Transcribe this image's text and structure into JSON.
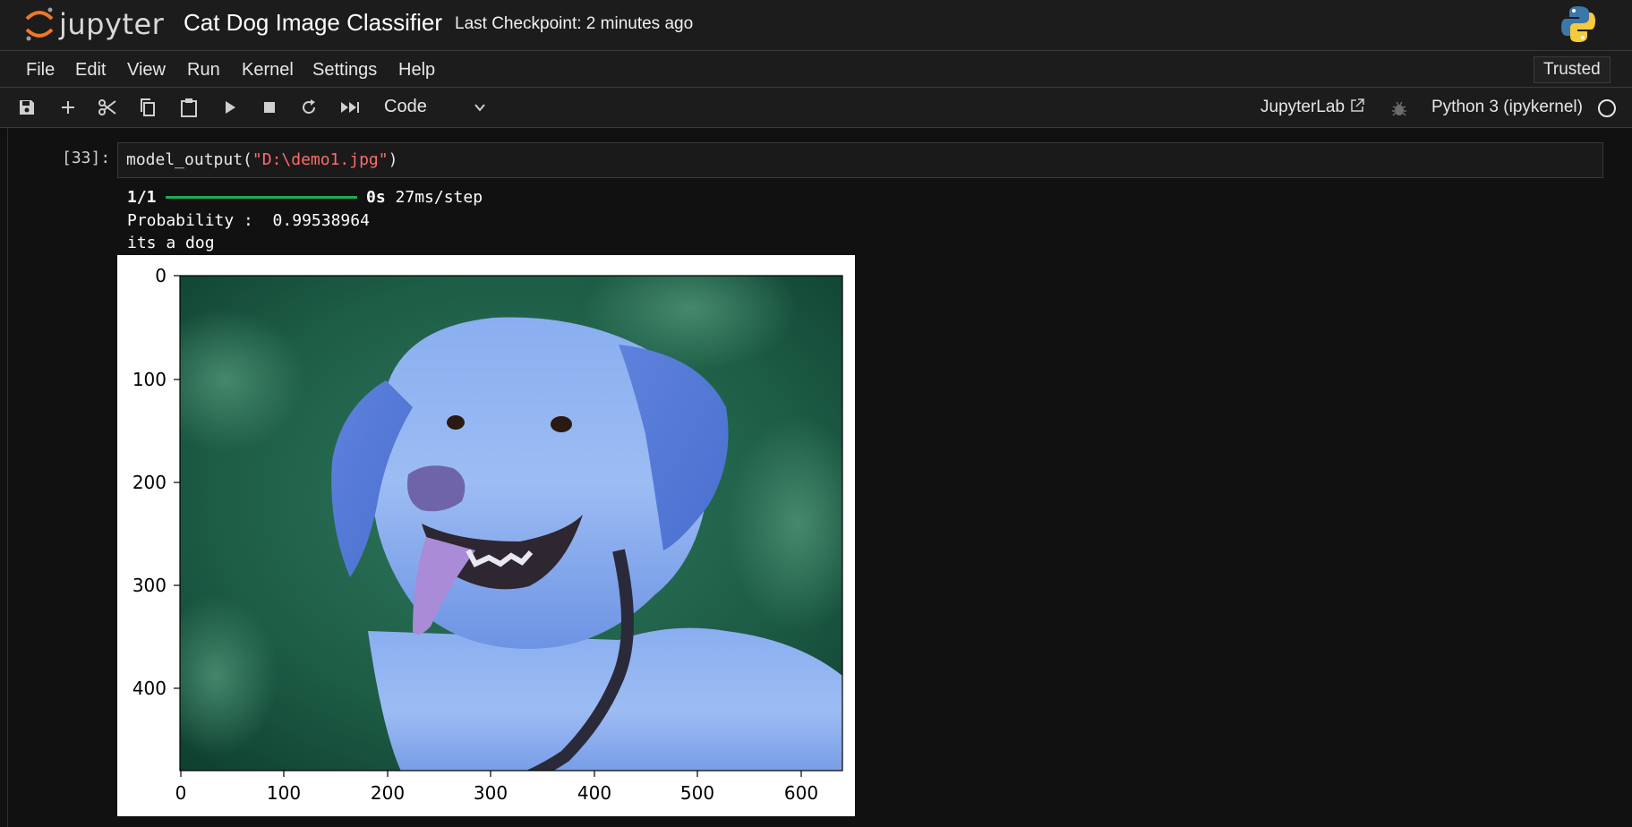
{
  "app": {
    "logo_text": "jupyter",
    "notebook_title": "Cat Dog Image Classifier",
    "checkpoint": "Last Checkpoint: 2 minutes ago"
  },
  "menu": {
    "items": [
      "File",
      "Edit",
      "View",
      "Run",
      "Kernel",
      "Settings",
      "Help"
    ],
    "trusted": "Trusted"
  },
  "toolbar": {
    "cell_type": "Code",
    "jupyterlab_label": "JupyterLab",
    "kernel_label": "Python 3 (ipykernel)",
    "icons": [
      "save-icon",
      "add-cell-icon",
      "cut-icon",
      "copy-icon",
      "paste-icon",
      "run-icon",
      "stop-icon",
      "restart-icon",
      "run-all-icon"
    ]
  },
  "cell": {
    "prompt": "[33]:",
    "code_prefix": "model_output(",
    "code_string": "\"D:\\demo1.jpg\"",
    "code_suffix": ")",
    "output_step": "1/1",
    "output_timing_bold": "0s",
    "output_timing": " 27ms/step",
    "output_probability": "Probability :  0.99538964",
    "output_label": "its a dog"
  },
  "chart_data": {
    "type": "image",
    "subject": "dog (blue-tinted labrador)",
    "x_ticks": [
      "0",
      "100",
      "200",
      "300",
      "400",
      "500",
      "600"
    ],
    "y_ticks": [
      "0",
      "100",
      "200",
      "300",
      "400"
    ],
    "xlim": [
      0,
      640
    ],
    "ylim": [
      480,
      0
    ]
  }
}
